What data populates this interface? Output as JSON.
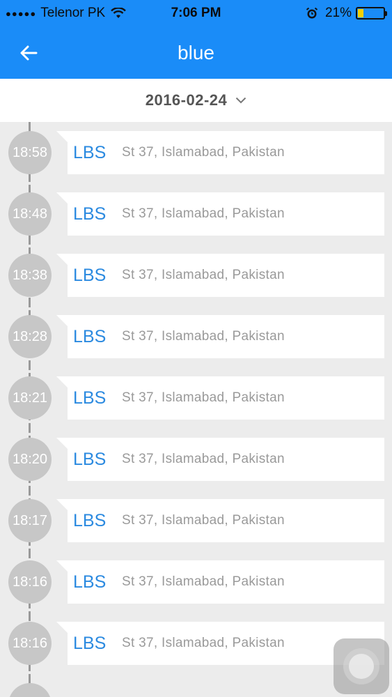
{
  "status_bar": {
    "signal_dots": "●●●●●",
    "carrier": "Telenor PK",
    "time": "7:06 PM",
    "battery_percent": "21%",
    "battery_level": 0.21,
    "battery_color": "#f3d000"
  },
  "header": {
    "title": "blue",
    "background_color": "#1a8cf8"
  },
  "date_selector": {
    "value": "2016-02-24"
  },
  "entries": [
    {
      "time": "18:58",
      "type": "LBS",
      "address": "St 37, Islamabad, Pakistan"
    },
    {
      "time": "18:48",
      "type": "LBS",
      "address": "St 37, Islamabad, Pakistan"
    },
    {
      "time": "18:38",
      "type": "LBS",
      "address": "St 37, Islamabad, Pakistan"
    },
    {
      "time": "18:28",
      "type": "LBS",
      "address": "St 37, Islamabad, Pakistan"
    },
    {
      "time": "18:21",
      "type": "LBS",
      "address": "St 37, Islamabad, Pakistan"
    },
    {
      "time": "18:20",
      "type": "LBS",
      "address": "St 37, Islamabad, Pakistan"
    },
    {
      "time": "18:17",
      "type": "LBS",
      "address": "St 37, Islamabad, Pakistan"
    },
    {
      "time": "18:16",
      "type": "LBS",
      "address": "St 37, Islamabad, Pakistan"
    },
    {
      "time": "18:16",
      "type": "LBS",
      "address": "St 37, Islamabad, Pakistan"
    }
  ]
}
